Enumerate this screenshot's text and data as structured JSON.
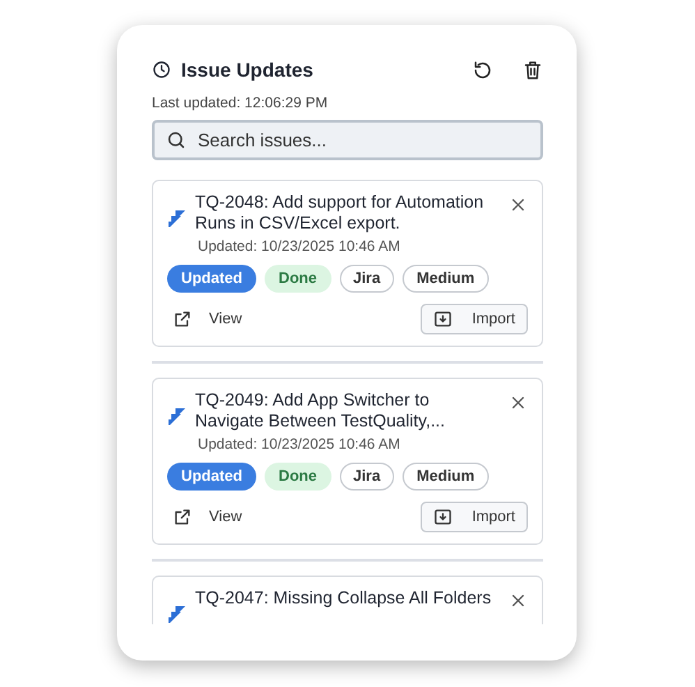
{
  "header": {
    "title": "Issue Updates",
    "last_updated": "Last updated: 12:06:29 PM"
  },
  "search": {
    "placeholder": "Search issues..."
  },
  "issues": [
    {
      "title": "TQ-2048: Add support for Automation Runs in CSV/Excel export.",
      "updated": "Updated: 10/23/2025 10:46 AM",
      "badges": [
        {
          "label": "Updated",
          "kind": "primary"
        },
        {
          "label": "Done",
          "kind": "success"
        },
        {
          "label": "Jira",
          "kind": "outline"
        },
        {
          "label": "Medium",
          "kind": "outline"
        }
      ],
      "view": "View",
      "import": "Import"
    },
    {
      "title": "TQ-2049: Add App Switcher to Navigate Between TestQuality,...",
      "updated": "Updated: 10/23/2025 10:46 AM",
      "badges": [
        {
          "label": "Updated",
          "kind": "primary"
        },
        {
          "label": "Done",
          "kind": "success"
        },
        {
          "label": "Jira",
          "kind": "outline"
        },
        {
          "label": "Medium",
          "kind": "outline"
        }
      ],
      "view": "View",
      "import": "Import"
    },
    {
      "title": "TQ-2047: Missing Collapse All Folders"
    }
  ]
}
